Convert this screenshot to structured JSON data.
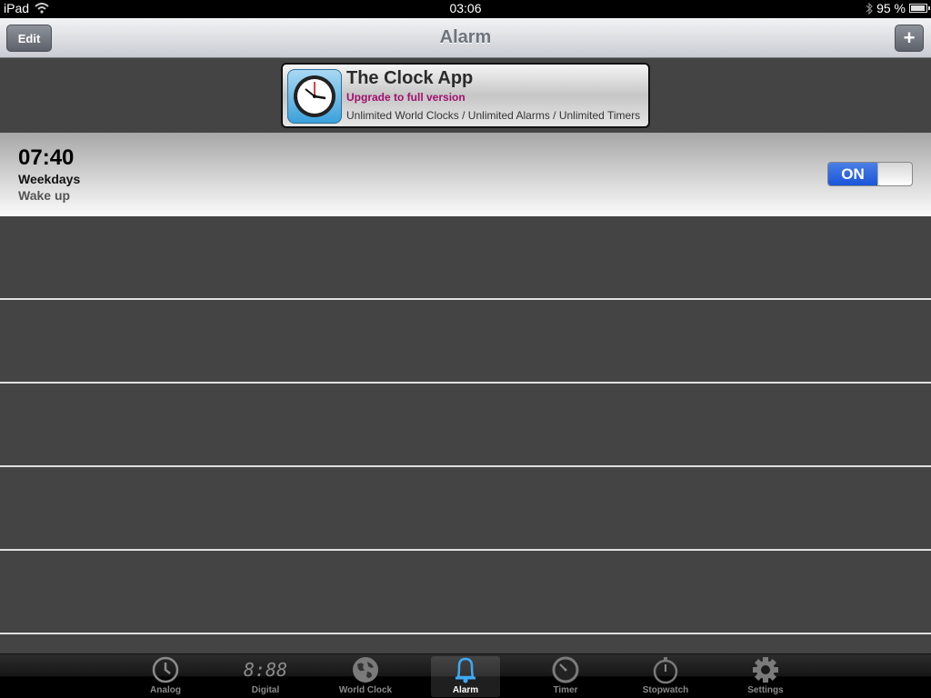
{
  "status_bar": {
    "device": "iPad",
    "time": "03:06",
    "battery": "95 %"
  },
  "nav": {
    "title": "Alarm",
    "edit_label": "Edit",
    "add_label": "+"
  },
  "ad": {
    "title": "The Clock App",
    "subtitle": "Upgrade to full version",
    "description": "Unlimited World Clocks / Unlimited Alarms / Unlimited Timers",
    "subtitle_color": "#a0106e"
  },
  "alarms": [
    {
      "time": "07:40",
      "repeat": "Weekdays",
      "label": "Wake up",
      "toggle_label": "ON",
      "enabled": true
    }
  ],
  "tabs": [
    {
      "label": "Analog",
      "icon": "analog-clock-icon"
    },
    {
      "label": "Digital",
      "icon": "digital-clock-icon",
      "glyph": "8:88"
    },
    {
      "label": "World Clock",
      "icon": "globe-icon"
    },
    {
      "label": "Alarm",
      "icon": "bell-icon",
      "active": true
    },
    {
      "label": "Timer",
      "icon": "timer-icon"
    },
    {
      "label": "Stopwatch",
      "icon": "stopwatch-icon"
    },
    {
      "label": "Settings",
      "icon": "gear-icon"
    }
  ],
  "colors": {
    "accent": "#2a62de",
    "active_tab_icon": "#3fa9f5"
  }
}
